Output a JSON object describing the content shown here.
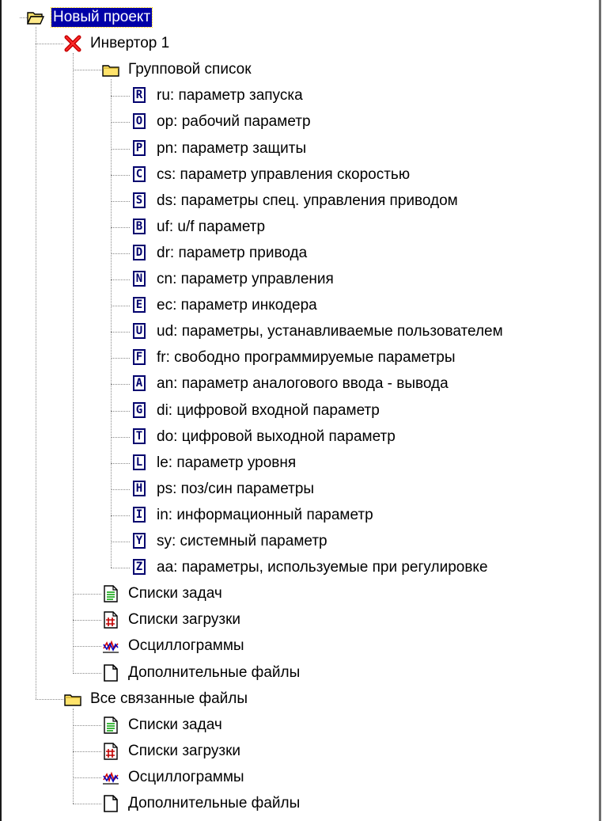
{
  "tree": {
    "root": {
      "label": "Новый проект",
      "icon": "open-folder-icon"
    },
    "inverter": {
      "label": "Инвертор 1",
      "icon": "red-x-icon"
    },
    "group_list": {
      "label": "Групповой список",
      "icon": "folder-icon"
    },
    "params": [
      {
        "letter": "R",
        "label": "ru: параметр запуска"
      },
      {
        "letter": "O",
        "label": "op: рабочий параметр"
      },
      {
        "letter": "P",
        "label": "pn: параметр защиты"
      },
      {
        "letter": "C",
        "label": "cs: параметр управления скоростью"
      },
      {
        "letter": "S",
        "label": "ds: параметры спец. управления приводом"
      },
      {
        "letter": "B",
        "label": "uf: u/f параметр"
      },
      {
        "letter": "D",
        "label": "dr: параметр привода"
      },
      {
        "letter": "N",
        "label": "cn: параметр управления"
      },
      {
        "letter": "E",
        "label": "ec: параметр инкодера"
      },
      {
        "letter": "U",
        "label": "ud: параметры, устанавливаемые пользователем"
      },
      {
        "letter": "F",
        "label": "fr: свободно программируемые параметры"
      },
      {
        "letter": "A",
        "label": "an: параметр аналогового ввода - вывода"
      },
      {
        "letter": "G",
        "label": "di: цифровой входной параметр"
      },
      {
        "letter": "T",
        "label": "do: цифровой выходной параметр"
      },
      {
        "letter": "L",
        "label": "le: параметр уровня"
      },
      {
        "letter": "H",
        "label": "ps: поз/син параметры"
      },
      {
        "letter": "I",
        "label": "in: информационный параметр"
      },
      {
        "letter": "Y",
        "label": "sy: системный параметр"
      },
      {
        "letter": "Z",
        "label": "aa: параметры, используемые при регулировке"
      }
    ],
    "inverter_files": [
      {
        "label": "Списки задач",
        "icon": "task-list-icon"
      },
      {
        "label": "Списки загрузки",
        "icon": "download-list-icon"
      },
      {
        "label": "Осциллограммы",
        "icon": "oscillogram-icon"
      },
      {
        "label": "Дополнительные файлы",
        "icon": "document-icon"
      }
    ],
    "related": {
      "label": "Все связанные файлы",
      "icon": "folder-icon"
    },
    "related_files": [
      {
        "label": "Списки задач",
        "icon": "task-list-icon"
      },
      {
        "label": "Списки загрузки",
        "icon": "download-list-icon"
      },
      {
        "label": "Осциллограммы",
        "icon": "oscillogram-icon"
      },
      {
        "label": "Дополнительные файлы",
        "icon": "document-icon"
      }
    ]
  }
}
